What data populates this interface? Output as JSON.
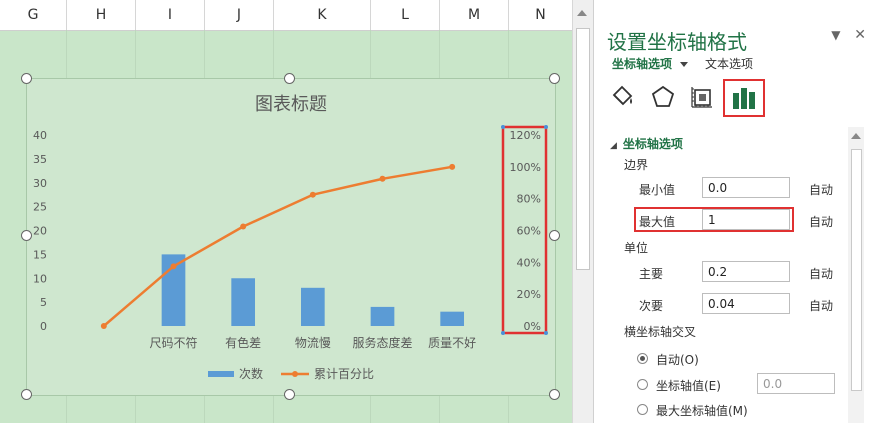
{
  "sheet": {
    "columns": [
      "G",
      "H",
      "I",
      "J",
      "K",
      "L",
      "M",
      "N"
    ]
  },
  "chart_data": {
    "type": "bar",
    "title": "图表标题",
    "categories": [
      "",
      "尺码不符",
      "有色差",
      "物流慢",
      "服务态度差",
      "质量不好"
    ],
    "series": [
      {
        "name": "次数",
        "type": "bar",
        "values": [
          0,
          15,
          10,
          8,
          4,
          3
        ],
        "color": "#5b9bd5",
        "axis": "primary"
      },
      {
        "name": "累计百分比",
        "type": "line",
        "values": [
          0,
          0.375,
          0.625,
          0.825,
          0.925,
          1.0
        ],
        "color": "#ed7d31",
        "axis": "secondary"
      }
    ],
    "primary_axis": {
      "ticks": [
        "0",
        "5",
        "10",
        "15",
        "20",
        "25",
        "30",
        "35",
        "40"
      ],
      "ylim": [
        0,
        40
      ]
    },
    "secondary_axis": {
      "ticks": [
        "0%",
        "20%",
        "40%",
        "60%",
        "80%",
        "100%",
        "120%"
      ],
      "ylim": [
        0,
        1.2
      ]
    },
    "legend": "bottom",
    "grid": false
  },
  "pane": {
    "title": "设置坐标轴格式",
    "controls": {
      "dropdown": "▼",
      "close": "✕"
    },
    "tabs": {
      "axis_options": "坐标轴选项",
      "text_options": "文本选项"
    },
    "icons": [
      "fill-line-icon",
      "effects-icon",
      "size-properties-icon",
      "axis-options-icon"
    ],
    "section_title": "坐标轴选项",
    "bounds": {
      "label": "边界",
      "min_label": "最小值",
      "min_value": "0.0",
      "min_auto": "自动",
      "max_label": "最大值",
      "max_value": "1",
      "max_auto": "自动"
    },
    "units": {
      "label": "单位",
      "major_label": "主要",
      "major_value": "0.2",
      "major_auto": "自动",
      "minor_label": "次要",
      "minor_value": "0.04",
      "minor_auto": "自动"
    },
    "crosses": {
      "label": "横坐标轴交叉",
      "auto": "自动(O)",
      "axis_value": "坐标轴值(E)",
      "axis_value_input": "0.0",
      "max_axis_value": "最大坐标轴值(M)"
    }
  }
}
